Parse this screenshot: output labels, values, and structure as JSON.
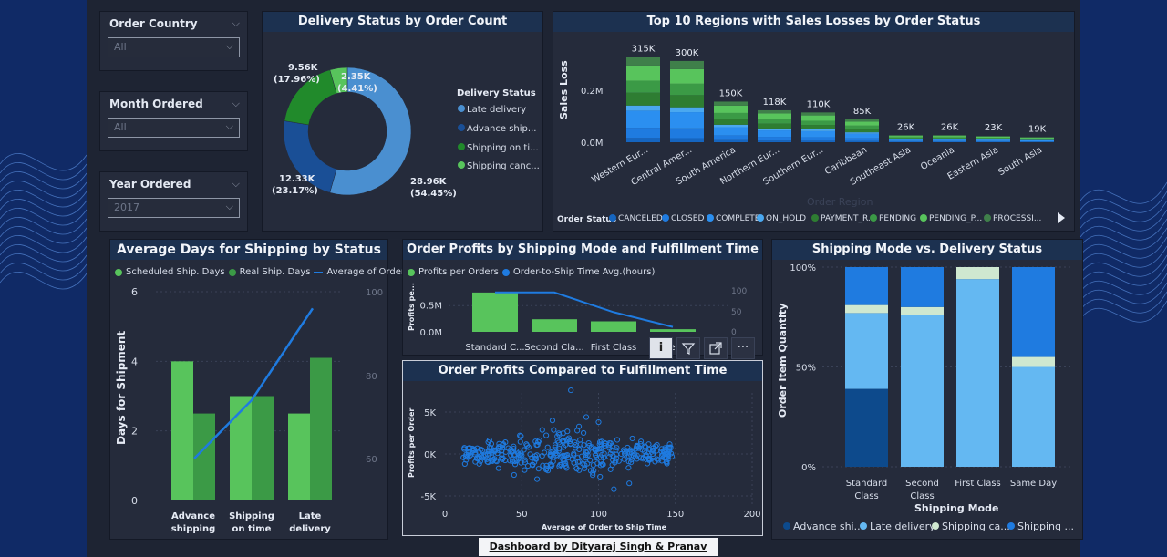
{
  "theme": {
    "bg": "#1e2433",
    "panel": "#252b3b",
    "title_bar": "#1c3150",
    "blue1": "#0d4a8c",
    "blue2": "#1f7be0",
    "blue3": "#4aa8f0",
    "blue4": "#64b8f2",
    "green1": "#58c45c",
    "green2": "#3b9a46",
    "green3": "#218a2b",
    "pale": "#cfe8d0"
  },
  "slicers": [
    {
      "label": "Order Country",
      "value": "All"
    },
    {
      "label": "Month Ordered",
      "value": "All"
    },
    {
      "label": "Year Ordered",
      "value": "2017"
    }
  ],
  "donut": {
    "title": "Delivery Status by Order Count",
    "legend_title": "Delivery Status",
    "legend": [
      "Late delivery",
      "Advance ship...",
      "Shipping on ti...",
      "Shipping canc..."
    ],
    "labels": [
      {
        "value": "28.96K",
        "pct": "(54.45%)"
      },
      {
        "value": "12.33K",
        "pct": "(23.17%)"
      },
      {
        "value": "9.56K",
        "pct": "(17.96%)"
      },
      {
        "value": "2.35K",
        "pct": "(4.41%)"
      }
    ]
  },
  "regions": {
    "title": "Top 10 Regions with Sales Losses by Order Status",
    "ylabel": "Sales Loss",
    "xlabel": "Order Region",
    "yticks": [
      "0.2M",
      "0.0M"
    ],
    "legend_title": "Order Status",
    "legend": [
      "CANCELED",
      "CLOSED",
      "COMPLETE",
      "ON_HOLD",
      "PAYMENT_R...",
      "PENDING",
      "PENDING_P...",
      "PROCESSI..."
    ]
  },
  "avgdays": {
    "title": "Average Days for Shipping by Status",
    "legend": [
      "Scheduled Ship. Days",
      "Real Ship. Days",
      "Average of Order..."
    ],
    "ylabel": "Days for Shipment",
    "yticks": [
      "6",
      "4",
      "2",
      "0"
    ],
    "y2ticks": [
      "100",
      "80",
      "60"
    ],
    "categories": [
      [
        "Advance",
        "shipping"
      ],
      [
        "Shipping",
        "on time"
      ],
      [
        "Late",
        "delivery"
      ]
    ]
  },
  "profits_mode": {
    "title": "Order Profits by Shipping Mode and Fulfillment Time",
    "legend": [
      "Profits per Orders",
      "Order-to-Ship Time Avg.(hours)"
    ],
    "ylabel": "Profits pe...",
    "yticks": [
      "0.5M",
      "0.0M"
    ],
    "y2ticks": [
      "100",
      "50",
      "0"
    ],
    "categories": [
      "Standard C...",
      "Second Cla...",
      "First Class",
      "Same Day"
    ]
  },
  "scatter": {
    "title": "Order Profits Compared to Fulfillment Time",
    "ylabel": "Profits per Order",
    "xlabel": "Average of Order to Ship Time",
    "yticks": [
      "5K",
      "0K",
      "-5K"
    ],
    "xticks": [
      "0",
      "50",
      "100",
      "150",
      "200"
    ]
  },
  "shipmode": {
    "title": "Shipping Mode vs. Delivery Status",
    "ylabel": "Order Item Quantity",
    "xlabel": "Shipping Mode",
    "yticks": [
      "100%",
      "50%",
      "0%"
    ],
    "categories": [
      [
        "Standard",
        "Class"
      ],
      [
        "Second",
        "Class"
      ],
      [
        "First Class",
        ""
      ],
      [
        "Same Day",
        ""
      ]
    ],
    "legend": [
      "Advance shi...",
      "Late delivery",
      "Shipping ca...",
      "Shipping ..."
    ]
  },
  "chart_data": [
    {
      "type": "pie",
      "title": "Delivery Status by Order Count",
      "categories": [
        "Late delivery",
        "Advance shipping",
        "Shipping on time",
        "Shipping canceled"
      ],
      "values": [
        28960,
        12330,
        9560,
        2350
      ],
      "percents": [
        54.45,
        23.17,
        17.96,
        4.41
      ]
    },
    {
      "type": "bar",
      "title": "Top 10 Regions with Sales Losses by Order Status",
      "categories": [
        "Western Eur...",
        "Central Amer...",
        "South America",
        "Northern Eur...",
        "Southern Eur...",
        "Caribbean",
        "Southeast Asia",
        "Oceania",
        "Eastern Asia",
        "South Asia"
      ],
      "values": [
        315000,
        300000,
        150000,
        118000,
        110000,
        85000,
        26000,
        26000,
        23000,
        19000
      ],
      "data_labels": [
        "315K",
        "300K",
        "150K",
        "118K",
        "110K",
        "85K",
        "26K",
        "26K",
        "23K",
        "19K"
      ]
    },
    {
      "type": "bar",
      "title": "Average Days for Shipping by Status",
      "categories": [
        "Advance shipping",
        "Shipping on time",
        "Late delivery"
      ],
      "series": [
        {
          "name": "Scheduled Ship. Days",
          "values": [
            4,
            3,
            2.5
          ]
        },
        {
          "name": "Real Ship. Days",
          "values": [
            2.5,
            3,
            4.1
          ]
        },
        {
          "name": "Average of Order...",
          "values": [
            60,
            74,
            96
          ]
        }
      ],
      "ylim": [
        0,
        6
      ]
    },
    {
      "type": "bar",
      "title": "Order Profits by Shipping Mode and Fulfillment Time",
      "categories": [
        "Standard C...",
        "Second Cla...",
        "First Class",
        "Same Day"
      ],
      "series": [
        {
          "name": "Profits per Orders",
          "values": [
            0.75,
            0.24,
            0.2,
            0.05
          ]
        },
        {
          "name": "Order-to-Ship Time Avg.(hours)",
          "values": [
            96,
            96,
            48,
            12
          ]
        }
      ]
    },
    {
      "type": "scatter",
      "title": "Order Profits Compared to Fulfillment Time",
      "xlabel": "Average of Order to Ship Time",
      "ylabel": "Profits per Order",
      "xlim": [
        0,
        200
      ],
      "ylim": [
        -5500,
        8000
      ]
    },
    {
      "type": "bar",
      "title": "Shipping Mode vs. Delivery Status",
      "categories": [
        "Standard Class",
        "Second Class",
        "First Class",
        "Same Day"
      ],
      "series": [
        {
          "name": "Advance shi...",
          "values": [
            39,
            0,
            0,
            0
          ]
        },
        {
          "name": "Late delivery",
          "values": [
            38,
            76,
            94,
            50
          ]
        },
        {
          "name": "Shipping ca...",
          "values": [
            4,
            4,
            6,
            5
          ]
        },
        {
          "name": "Shipping ...",
          "values": [
            19,
            20,
            0,
            45
          ]
        }
      ],
      "ylim": [
        0,
        100
      ]
    }
  ],
  "toolbar": {
    "icons": [
      "info-icon",
      "filter-icon",
      "focus-icon",
      "more-icon"
    ]
  },
  "credit": "Dashboard by Dityaraj Singh & Pranav Khairnar"
}
